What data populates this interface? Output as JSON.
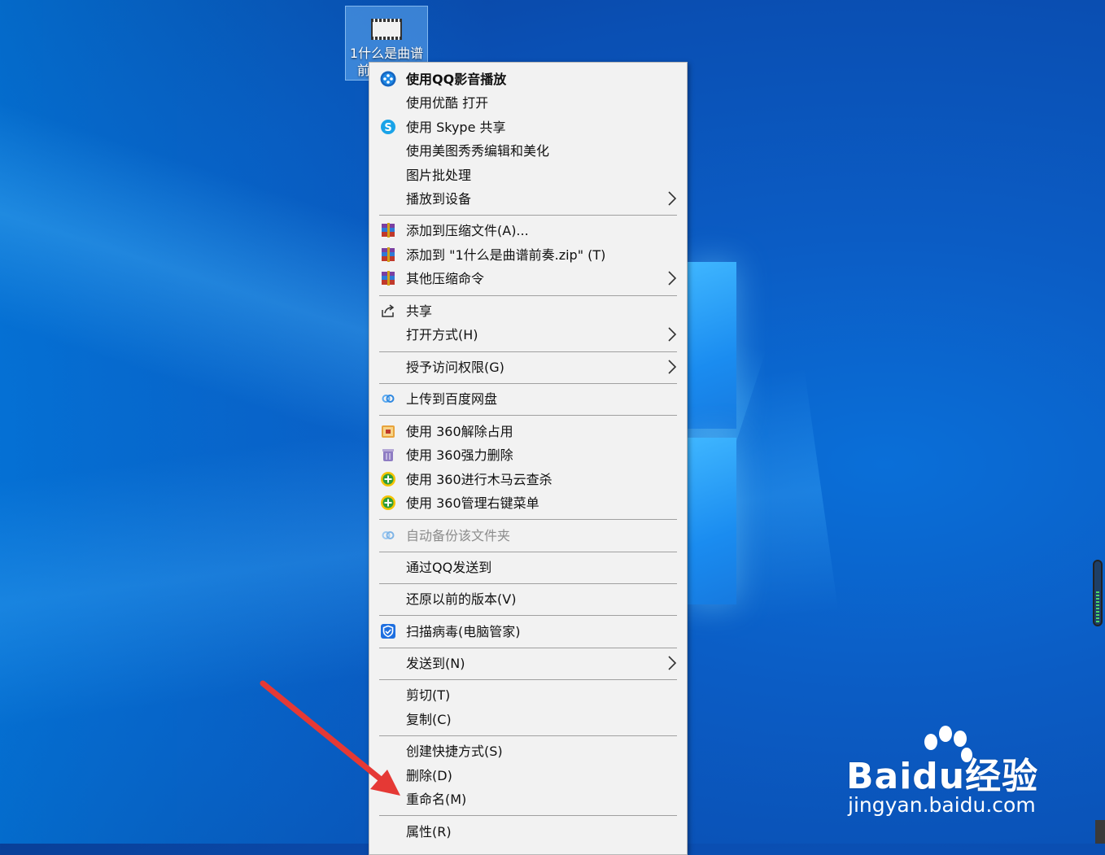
{
  "desktop": {
    "icon_label_line1": "1什么是曲谱",
    "icon_label_line2": "前"
  },
  "context_menu": {
    "items": [
      {
        "label": "使用QQ影音播放",
        "icon": "qq-player-icon",
        "bold": true
      },
      {
        "label": "使用优酷 打开",
        "icon": ""
      },
      {
        "label": "使用 Skype 共享",
        "icon": "skype-icon"
      },
      {
        "label": "使用美图秀秀编辑和美化",
        "icon": ""
      },
      {
        "label": "图片批处理",
        "icon": ""
      },
      {
        "label": "播放到设备",
        "icon": "",
        "submenu": true
      },
      {
        "label": "添加到压缩文件(A)...",
        "icon": "winrar-icon"
      },
      {
        "label": "添加到 \"1什么是曲谱前奏.zip\" (T)",
        "icon": "winrar-icon"
      },
      {
        "label": "其他压缩命令",
        "icon": "winrar-icon",
        "submenu": true
      },
      {
        "label": "共享",
        "icon": "share-icon"
      },
      {
        "label": "打开方式(H)",
        "icon": "",
        "submenu": true
      },
      {
        "label": "授予访问权限(G)",
        "icon": "",
        "submenu": true
      },
      {
        "label": "上传到百度网盘",
        "icon": "baidu-netdisk-icon"
      },
      {
        "label": "使用 360解除占用",
        "icon": "360-unlock-icon"
      },
      {
        "label": "使用 360强力删除",
        "icon": "360-delete-icon"
      },
      {
        "label": "使用 360进行木马云查杀",
        "icon": "360-scan-icon"
      },
      {
        "label": "使用 360管理右键菜单",
        "icon": "360-manage-icon"
      },
      {
        "label": "自动备份该文件夹",
        "icon": "baidu-netdisk-icon",
        "disabled": true
      },
      {
        "label": "通过QQ发送到",
        "icon": ""
      },
      {
        "label": "还原以前的版本(V)",
        "icon": ""
      },
      {
        "label": "扫描病毒(电脑管家)",
        "icon": "tencent-pcmgr-icon"
      },
      {
        "label": "发送到(N)",
        "icon": "",
        "submenu": true
      },
      {
        "label": "剪切(T)",
        "icon": ""
      },
      {
        "label": "复制(C)",
        "icon": ""
      },
      {
        "label": "创建快捷方式(S)",
        "icon": ""
      },
      {
        "label": "删除(D)",
        "icon": ""
      },
      {
        "label": "重命名(M)",
        "icon": ""
      },
      {
        "label": "属性(R)",
        "icon": ""
      }
    ]
  },
  "watermark": {
    "brand": "Baidu经验",
    "url": "jingyan.baidu.com"
  },
  "annotation": {
    "arrow_color": "#e53935"
  }
}
